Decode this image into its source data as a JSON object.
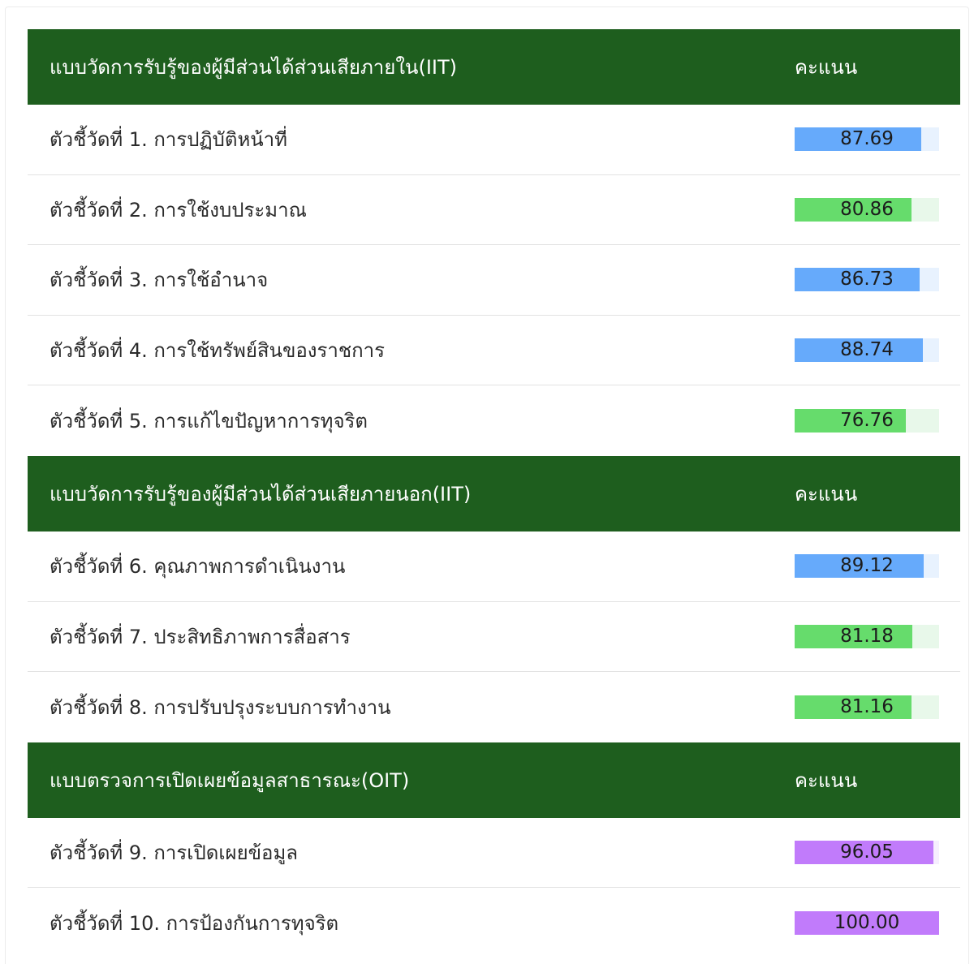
{
  "colors": {
    "header_bg": "#1e5e1e",
    "blue": "#66aafb",
    "blue_track": "#e8f2fe",
    "green": "#66dc6c",
    "green_track": "#e8f8ea",
    "purple": "#c17bfb",
    "purple_track": "#f6eefe"
  },
  "sections": [
    {
      "title": "แบบวัดการรับรู้ของผู้มีส่วนได้ส่วนเสียภายใน(IIT)",
      "score_header": "คะแนน",
      "rows": [
        {
          "label": "ตัวชี้วัดที่ 1. การปฏิบัติหน้าที่",
          "score": "87.69",
          "value": 87.69,
          "color": "blue"
        },
        {
          "label": "ตัวชี้วัดที่ 2. การใช้งบประมาณ",
          "score": "80.86",
          "value": 80.86,
          "color": "green"
        },
        {
          "label": "ตัวชี้วัดที่ 3. การใช้อำนาจ",
          "score": "86.73",
          "value": 86.73,
          "color": "blue"
        },
        {
          "label": "ตัวชี้วัดที่ 4. การใช้ทรัพย์สินของราชการ",
          "score": "88.74",
          "value": 88.74,
          "color": "blue"
        },
        {
          "label": "ตัวชี้วัดที่ 5. การแก้ไขปัญหาการทุจริต",
          "score": "76.76",
          "value": 76.76,
          "color": "green"
        }
      ]
    },
    {
      "title": "แบบวัดการรับรู้ของผู้มีส่วนได้ส่วนเสียภายนอก(IIT)",
      "score_header": "คะแนน",
      "rows": [
        {
          "label": "ตัวชี้วัดที่ 6. คุณภาพการดำเนินงาน",
          "score": "89.12",
          "value": 89.12,
          "color": "blue"
        },
        {
          "label": "ตัวชี้วัดที่ 7. ประสิทธิภาพการสื่อสาร",
          "score": "81.18",
          "value": 81.18,
          "color": "green"
        },
        {
          "label": "ตัวชี้วัดที่ 8. การปรับปรุงระบบการทำงาน",
          "score": "81.16",
          "value": 81.16,
          "color": "green"
        }
      ]
    },
    {
      "title": "แบบตรวจการเปิดเผยข้อมูลสาธารณะ(OIT)",
      "score_header": "คะแนน",
      "rows": [
        {
          "label": "ตัวชี้วัดที่ 9. การเปิดเผยข้อมูล",
          "score": "96.05",
          "value": 96.05,
          "color": "purple"
        },
        {
          "label": "ตัวชี้วัดที่ 10. การป้องกันการทุจริต",
          "score": "100.00",
          "value": 100.0,
          "color": "purple"
        }
      ]
    }
  ]
}
